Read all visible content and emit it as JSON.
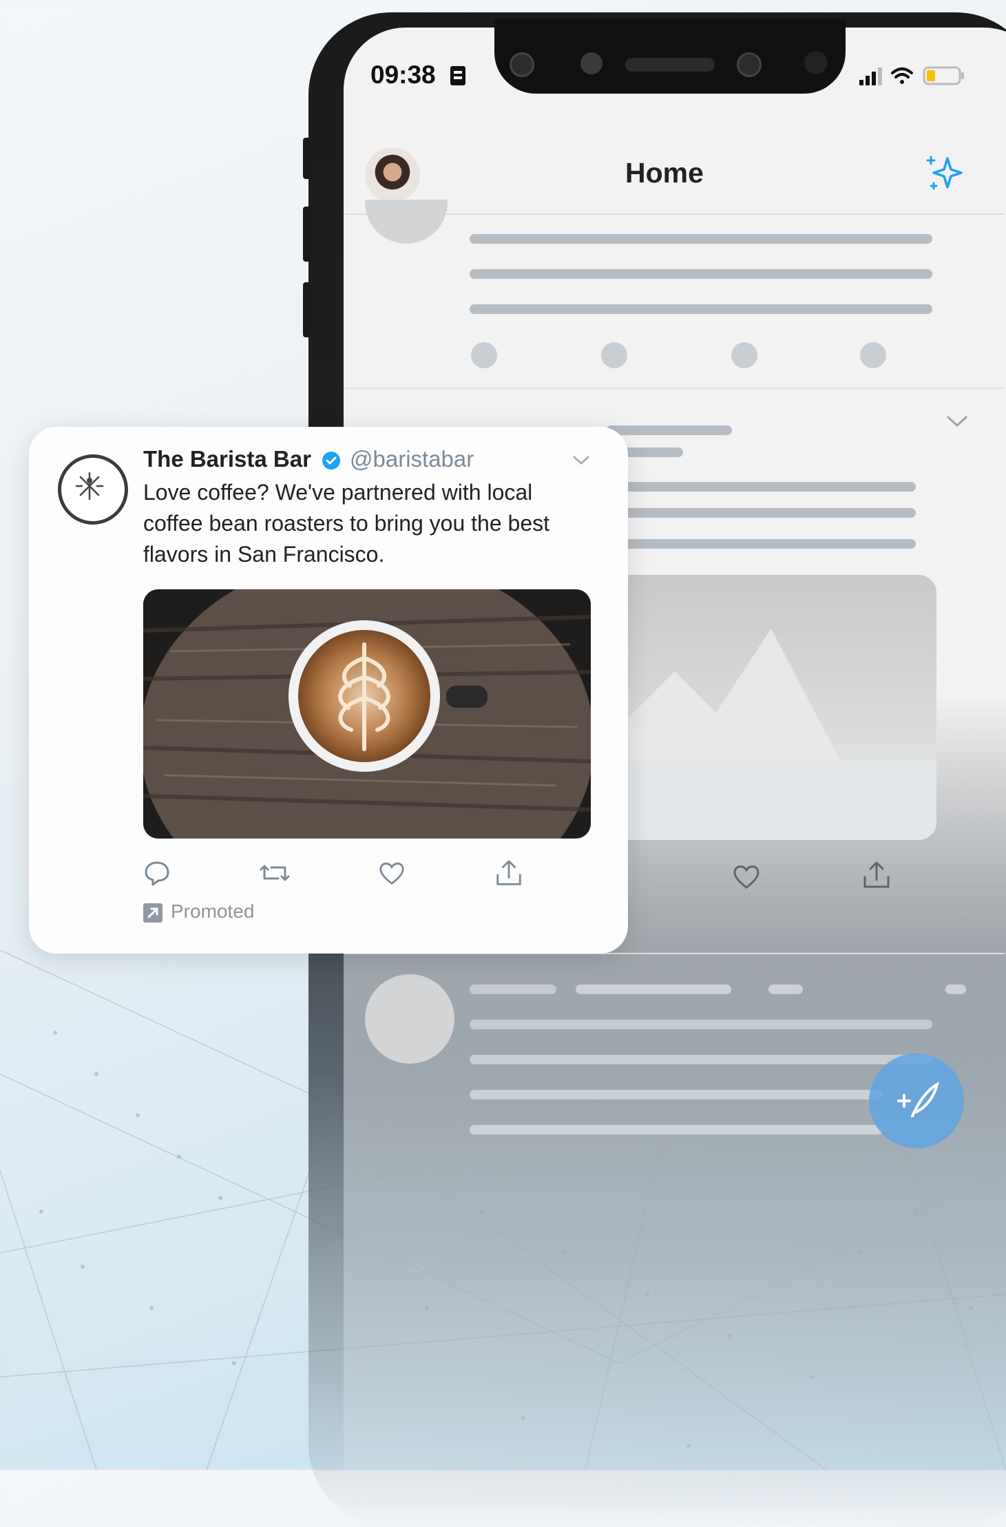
{
  "status_bar": {
    "time": "09:38"
  },
  "header": {
    "title": "Home"
  },
  "tweet": {
    "account_name": "The Barista Bar",
    "handle": "@baristabar",
    "text": "Love coffee? We've partnered with local coffee bean roasters to bring you the best flavors in San Francisco.",
    "promoted_label": "Promoted",
    "actions": [
      "reply-icon",
      "retweet-icon",
      "like-icon",
      "share-icon"
    ]
  },
  "colors": {
    "accent": "#1da1f2",
    "fab": "#5fa5e1",
    "skeleton": "#b5bcc2"
  }
}
